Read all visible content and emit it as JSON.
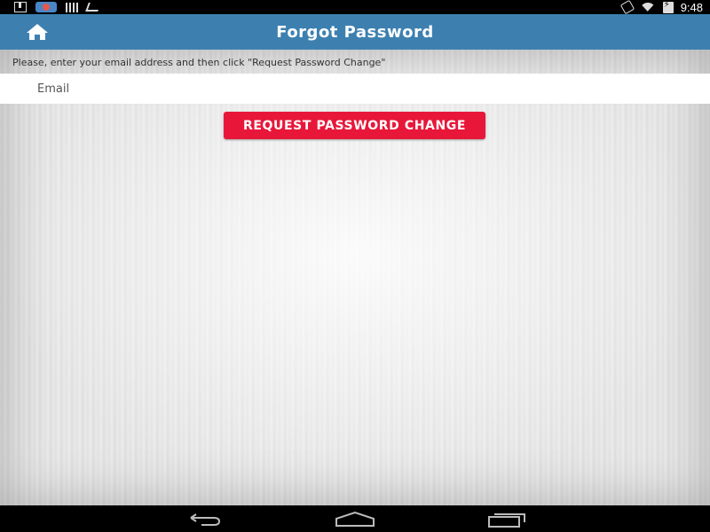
{
  "status_bar": {
    "time": "9:48",
    "left_icons": [
      "download-icon",
      "app-notification-icon",
      "signal-bars-icon",
      "airplane-notification-icon"
    ],
    "right_icons": [
      "vibrate-mute-icon",
      "wifi-icon",
      "battery-charging-icon"
    ]
  },
  "app_bar": {
    "title": "Forgot Password",
    "home_icon": "home-icon",
    "color": "#3d80b0"
  },
  "form": {
    "instructions": "Please, enter your email address and then click \"Request Password Change\"",
    "email_placeholder": "Email",
    "email_value": "",
    "submit_label": "REQUEST PASSWORD CHANGE",
    "submit_color": "#e8173a"
  },
  "nav_bar": {
    "icons": [
      "back-icon",
      "home-nav-icon",
      "recents-icon"
    ]
  }
}
